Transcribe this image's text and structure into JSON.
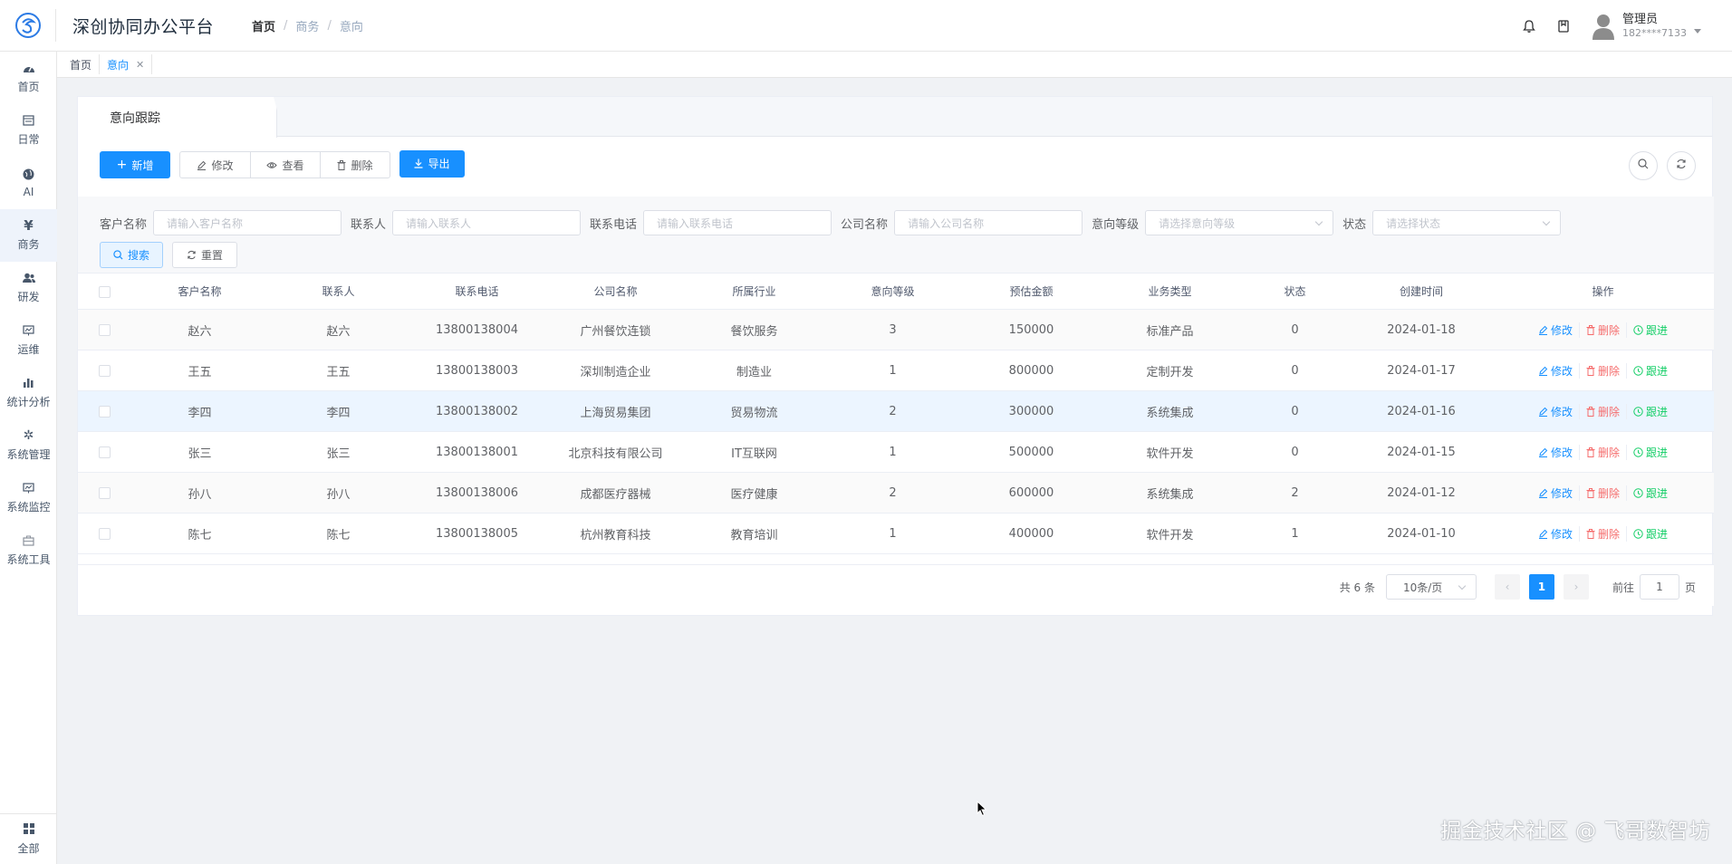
{
  "header": {
    "app_title": "深创协同办公平台",
    "breadcrumb": [
      "首页",
      "商务",
      "意向"
    ],
    "user_name": "管理员",
    "user_phone": "182****7133"
  },
  "sidebar": {
    "items": [
      {
        "label": "首页",
        "icon": "dashboard-icon"
      },
      {
        "label": "日常",
        "icon": "calendar-icon"
      },
      {
        "label": "AI",
        "icon": "globe-icon"
      },
      {
        "label": "商务",
        "icon": "yen-icon",
        "active": true
      },
      {
        "label": "研发",
        "icon": "users-icon"
      },
      {
        "label": "运维",
        "icon": "monitor-icon"
      },
      {
        "label": "统计分析",
        "icon": "bar-chart-icon"
      },
      {
        "label": "系统管理",
        "icon": "gear-icon"
      },
      {
        "label": "系统监控",
        "icon": "monitor-icon"
      },
      {
        "label": "系统工具",
        "icon": "toolbox-icon"
      }
    ],
    "bottom_label": "全部"
  },
  "tags": {
    "items": [
      "首页",
      "意向"
    ],
    "active": "意向"
  },
  "card": {
    "tab_label": "意向跟踪"
  },
  "toolbar": {
    "add_label": "新增",
    "edit_label": "修改",
    "view_label": "查看",
    "delete_label": "删除",
    "export_label": "导出"
  },
  "filters": {
    "customer_label": "客户名称",
    "customer_placeholder": "请输入客户名称",
    "contact_label": "联系人",
    "contact_placeholder": "请输入联系人",
    "phone_label": "联系电话",
    "phone_placeholder": "请输入联系电话",
    "company_label": "公司名称",
    "company_placeholder": "请输入公司名称",
    "level_label": "意向等级",
    "level_placeholder": "请选择意向等级",
    "status_label": "状态",
    "status_placeholder": "请选择状态",
    "search_label": "搜索",
    "reset_label": "重置"
  },
  "table": {
    "columns": [
      "客户名称",
      "联系人",
      "联系电话",
      "公司名称",
      "所属行业",
      "意向等级",
      "预估金额",
      "业务类型",
      "状态",
      "创建时间",
      "操作"
    ],
    "rows": [
      [
        "赵六",
        "赵六",
        "13800138004",
        "广州餐饮连锁",
        "餐饮服务",
        "3",
        "150000",
        "标准产品",
        "0",
        "2024-01-18"
      ],
      [
        "王五",
        "王五",
        "13800138003",
        "深圳制造企业",
        "制造业",
        "1",
        "800000",
        "定制开发",
        "0",
        "2024-01-17"
      ],
      [
        "李四",
        "李四",
        "13800138002",
        "上海贸易集团",
        "贸易物流",
        "2",
        "300000",
        "系统集成",
        "0",
        "2024-01-16"
      ],
      [
        "张三",
        "张三",
        "13800138001",
        "北京科技有限公司",
        "IT互联网",
        "1",
        "500000",
        "软件开发",
        "0",
        "2024-01-15"
      ],
      [
        "孙八",
        "孙八",
        "13800138006",
        "成都医疗器械",
        "医疗健康",
        "2",
        "600000",
        "系统集成",
        "2",
        "2024-01-12"
      ],
      [
        "陈七",
        "陈七",
        "13800138005",
        "杭州教育科技",
        "教育培训",
        "1",
        "400000",
        "软件开发",
        "1",
        "2024-01-10"
      ]
    ],
    "op_edit": "修改",
    "op_delete": "删除",
    "op_follow": "跟进"
  },
  "pagination": {
    "total_text": "共 6 条",
    "page_size": "10条/页",
    "current_page": "1",
    "goto_prefix": "前往",
    "goto_value": "1",
    "goto_suffix": "页"
  },
  "watermark": "掘金技术社区 @ 飞哥数智坊"
}
